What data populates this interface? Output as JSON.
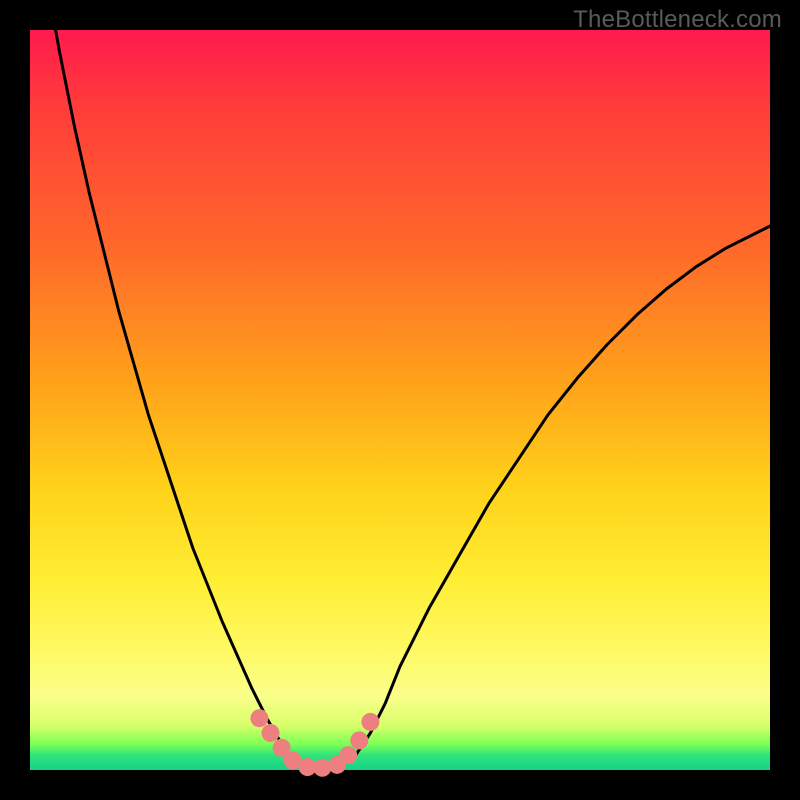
{
  "watermark": "TheBottleneck.com",
  "colors": {
    "frame": "#000000",
    "watermark": "#5a5a5a",
    "curve": "#000000",
    "marker": "#ed7f80",
    "gradient_stops": [
      "#ff1a4d",
      "#ff3b3b",
      "#ff6a2a",
      "#ffa31a",
      "#ffd21a",
      "#ffed33",
      "#fff75a",
      "#fbff8a",
      "#d7ff6a",
      "#7dff55",
      "#2fe47a",
      "#17d18a"
    ]
  },
  "chart_data": {
    "type": "line",
    "title": "",
    "xlabel": "",
    "ylabel": "",
    "xlim": [
      0,
      100
    ],
    "ylim": [
      0,
      100
    ],
    "x": [
      0,
      2,
      4,
      6,
      8,
      10,
      12,
      14,
      16,
      18,
      20,
      22,
      24,
      26,
      28,
      30,
      32,
      34,
      35,
      36,
      38,
      40,
      42,
      44,
      46,
      48,
      50,
      54,
      58,
      62,
      66,
      70,
      74,
      78,
      82,
      86,
      90,
      94,
      98,
      100
    ],
    "values": [
      120,
      108,
      97,
      87,
      78,
      70,
      62,
      55,
      48,
      42,
      36,
      30,
      25,
      20,
      15.5,
      11,
      7,
      3.5,
      2,
      1,
      0,
      0,
      0.5,
      2,
      5,
      9,
      14,
      22,
      29,
      36,
      42,
      48,
      53,
      57.5,
      61.5,
      65,
      68,
      70.5,
      72.5,
      73.5
    ],
    "series": [
      {
        "name": "curve",
        "x": [
          0,
          2,
          4,
          6,
          8,
          10,
          12,
          14,
          16,
          18,
          20,
          22,
          24,
          26,
          28,
          30,
          32,
          34,
          35,
          36,
          38,
          40,
          42,
          44,
          46,
          48,
          50,
          54,
          58,
          62,
          66,
          70,
          74,
          78,
          82,
          86,
          90,
          94,
          98,
          100
        ],
        "values": [
          120,
          108,
          97,
          87,
          78,
          70,
          62,
          55,
          48,
          42,
          36,
          30,
          25,
          20,
          15.5,
          11,
          7,
          3.5,
          2,
          1,
          0,
          0,
          0.5,
          2,
          5,
          9,
          14,
          22,
          29,
          36,
          42,
          48,
          53,
          57.5,
          61.5,
          65,
          68,
          70.5,
          72.5,
          73.5
        ]
      },
      {
        "name": "markers",
        "x": [
          31,
          32.5,
          34,
          35.5,
          37.5,
          39.5,
          41.5,
          43,
          44.5,
          46
        ],
        "values": [
          7,
          5,
          3,
          1.3,
          0.4,
          0.3,
          0.7,
          2,
          4,
          6.5
        ]
      }
    ]
  }
}
